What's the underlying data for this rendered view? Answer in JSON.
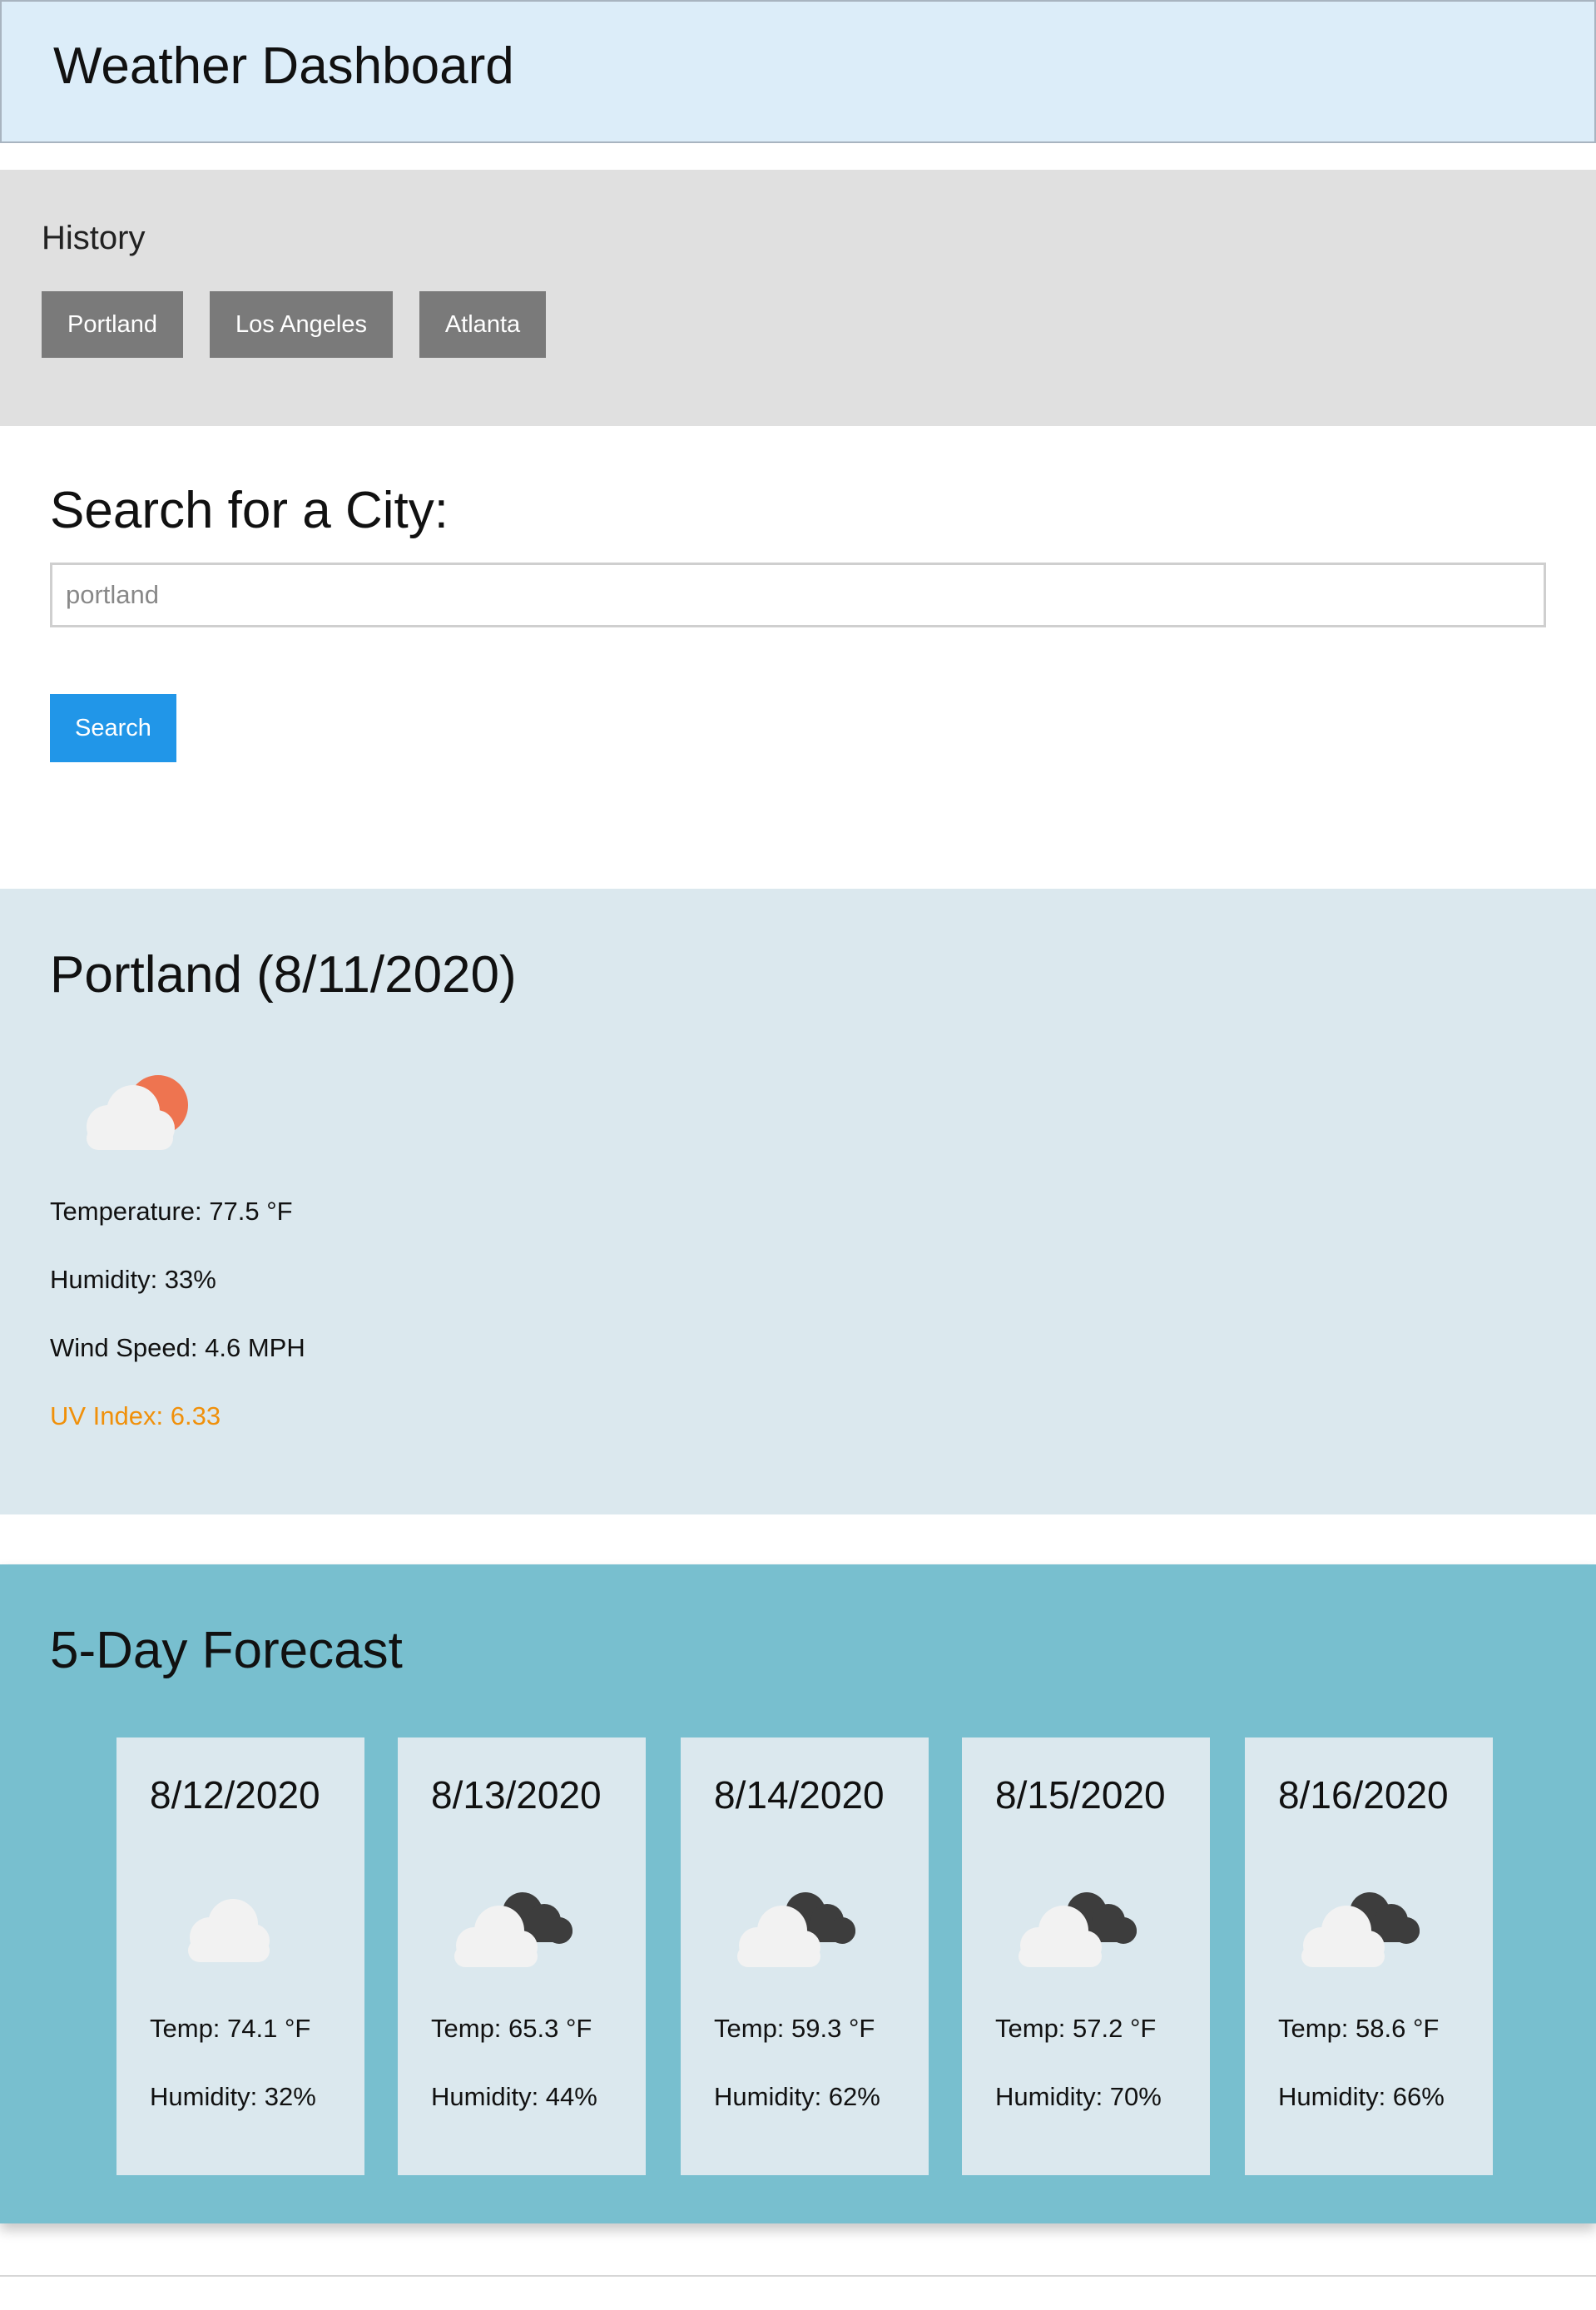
{
  "header": {
    "title": "Weather Dashboard"
  },
  "history": {
    "label": "History",
    "cities": [
      "Portland",
      "Los Angeles",
      "Atlanta"
    ]
  },
  "search": {
    "heading": "Search for a City:",
    "input_placeholder": "portland",
    "button_label": "Search"
  },
  "current": {
    "heading": "Portland (8/11/2020)",
    "icon": "cloud-sun-icon",
    "temperature": "Temperature: 77.5 °F",
    "humidity": "Humidity: 33%",
    "wind": "Wind Speed: 4.6 MPH",
    "uv": "UV Index: 6.33",
    "uv_color": "#f0900a"
  },
  "forecast": {
    "heading": "5-Day Forecast",
    "days": [
      {
        "date": "8/12/2020",
        "icon": "cloud-icon",
        "temp": "Temp: 74.1 °F",
        "humidity": "Humidity: 32%"
      },
      {
        "date": "8/13/2020",
        "icon": "cloud-dark-cloud-icon",
        "temp": "Temp: 65.3 °F",
        "humidity": "Humidity: 44%"
      },
      {
        "date": "8/14/2020",
        "icon": "cloud-dark-cloud-icon",
        "temp": "Temp: 59.3 °F",
        "humidity": "Humidity: 62%"
      },
      {
        "date": "8/15/2020",
        "icon": "cloud-dark-cloud-icon",
        "temp": "Temp: 57.2 °F",
        "humidity": "Humidity: 70%"
      },
      {
        "date": "8/16/2020",
        "icon": "cloud-dark-cloud-icon",
        "temp": "Temp: 58.6 °F",
        "humidity": "Humidity: 66%"
      }
    ]
  },
  "colors": {
    "header_bg": "#dcedf9",
    "history_bg": "#e0e0e0",
    "history_button": "#7a7a7a",
    "search_button": "#2196e8",
    "current_bg": "#dbe8ee",
    "forecast_bg": "#78bfcf"
  }
}
